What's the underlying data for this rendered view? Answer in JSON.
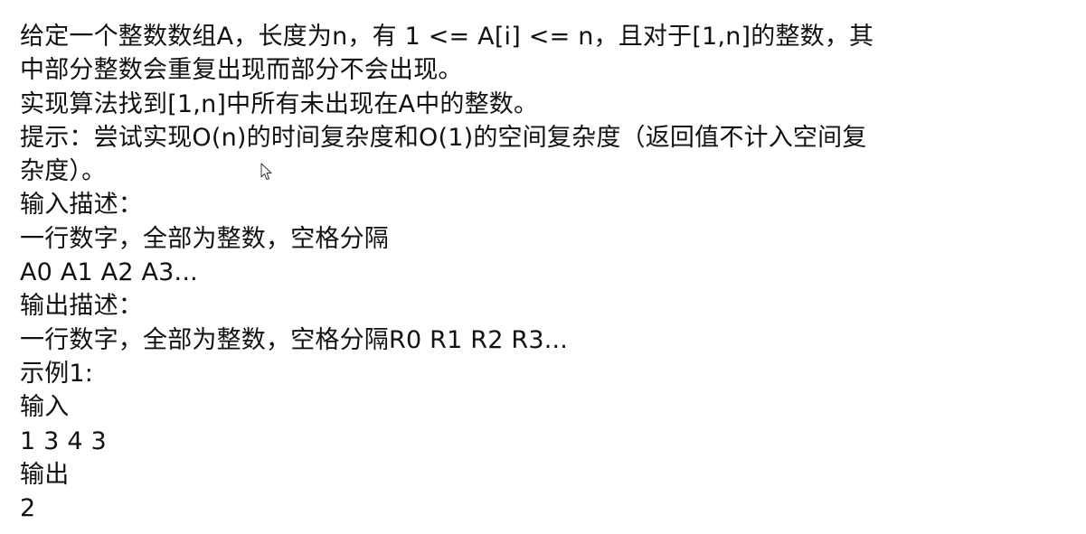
{
  "document": {
    "lines": [
      "给定一个整数数组A，长度为n，有 1 <= A[i] <= n，且对于[1,n]的整数，其",
      "中部分整数会重复出现而部分不会出现。",
      "实现算法找到[1,n]中所有未出现在A中的整数。",
      "提示：尝试实现O(n)的时间复杂度和O(1)的空间复杂度（返回值不计入空间复",
      "杂度）。",
      "输入描述：",
      "一行数字，全部为整数，空格分隔",
      "A0 A1 A2 A3...",
      "输出描述：",
      "一行数字，全部为整数，空格分隔R0 R1 R2 R3...",
      "示例1:",
      "输入",
      "1 3 4 3",
      "输出",
      "2"
    ]
  },
  "icons": {
    "cursor": "mouse-pointer-icon"
  }
}
